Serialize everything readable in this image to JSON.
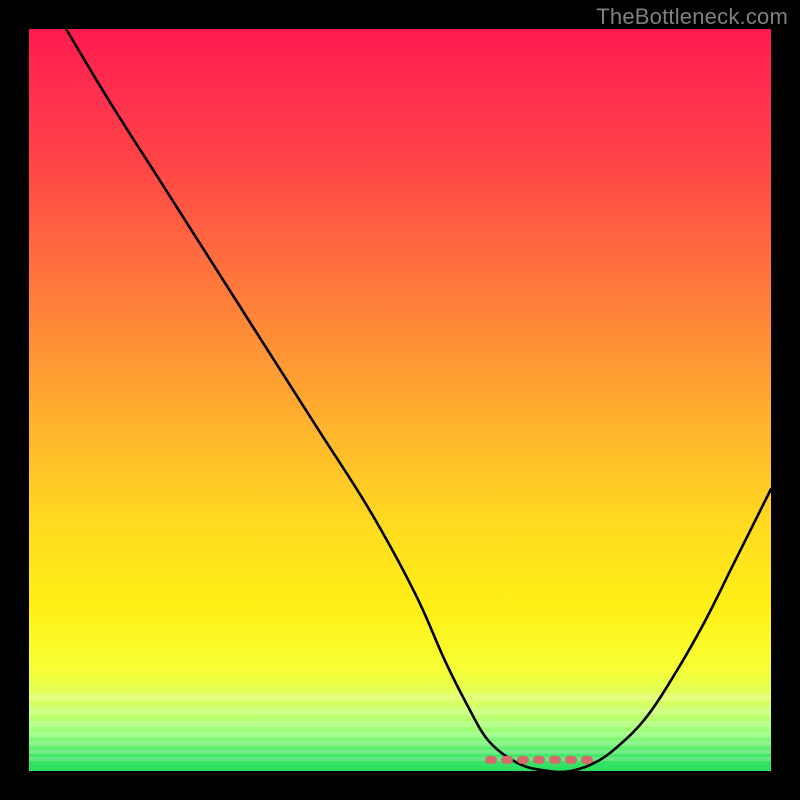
{
  "watermark": "TheBottleneck.com",
  "chart_data": {
    "type": "line",
    "title": "",
    "xlabel": "",
    "ylabel": "",
    "xlim": [
      0,
      100
    ],
    "ylim": [
      0,
      100
    ],
    "grid": false,
    "series": [
      {
        "name": "bottleneck-curve",
        "x": [
          5,
          11,
          18,
          25,
          32,
          39,
          46,
          52,
          56,
          59,
          62,
          66,
          70,
          73,
          76,
          79,
          83,
          87,
          91,
          95,
          100
        ],
        "values": [
          100,
          90,
          79,
          68,
          57,
          46,
          35,
          24,
          15,
          9,
          4,
          1,
          0,
          0,
          1,
          3,
          7,
          13,
          20,
          28,
          38
        ]
      }
    ],
    "annotations": [
      {
        "name": "optimal-range-marker",
        "x_start": 62,
        "x_end": 76,
        "y": 1.5,
        "color": "#d46a6a"
      }
    ],
    "background_gradient_stops": [
      {
        "pos": 0.0,
        "color": "#ff1a4d"
      },
      {
        "pos": 0.3,
        "color": "#ff6a3f"
      },
      {
        "pos": 0.55,
        "color": "#ffb82c"
      },
      {
        "pos": 0.8,
        "color": "#fff016"
      },
      {
        "pos": 0.95,
        "color": "#96ff7a"
      },
      {
        "pos": 1.0,
        "color": "#28e060"
      }
    ]
  }
}
